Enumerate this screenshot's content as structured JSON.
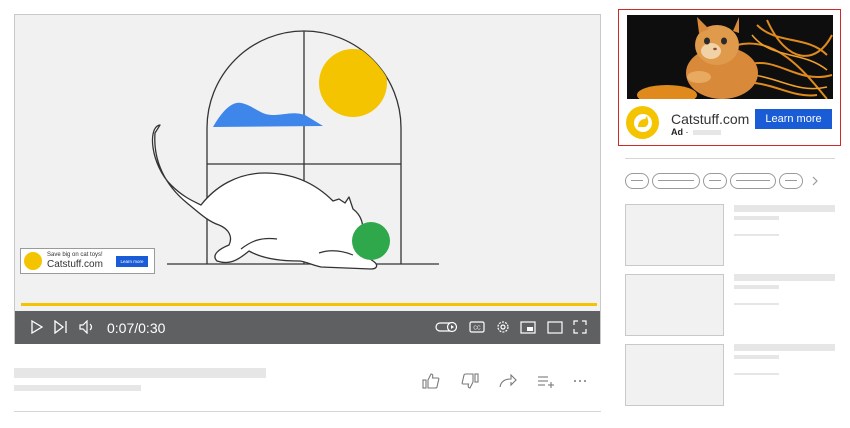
{
  "player": {
    "time": "0:07/0:30",
    "progress_fraction": 0.23,
    "icons": [
      "play-icon",
      "next-icon",
      "volume-icon",
      "autoplay-toggle-icon",
      "captions-icon",
      "settings-icon",
      "miniplayer-icon",
      "theater-mode-icon",
      "fullscreen-icon"
    ]
  },
  "overlay_ad": {
    "tagline": "Save big on cat toys!",
    "domain": "Catstuff.com",
    "button_label": "Learn more"
  },
  "companion_ad": {
    "domain": "Catstuff.com",
    "ad_label": "Ad",
    "ad_separator": "·",
    "button_label": "Learn more"
  },
  "actions": {
    "icons": [
      "like-icon",
      "dislike-icon",
      "share-icon",
      "save-to-playlist-icon",
      "more-icon"
    ]
  },
  "chips_more_icon": "chevron-right-icon",
  "colors": {
    "accent_yellow": "#f5c400",
    "button_blue": "#1a5bd6",
    "companion_border": "#cf2a2a",
    "control_bar": "#5f6062",
    "ball_green": "#2ea84a",
    "cloud_blue": "#3f86ea"
  }
}
